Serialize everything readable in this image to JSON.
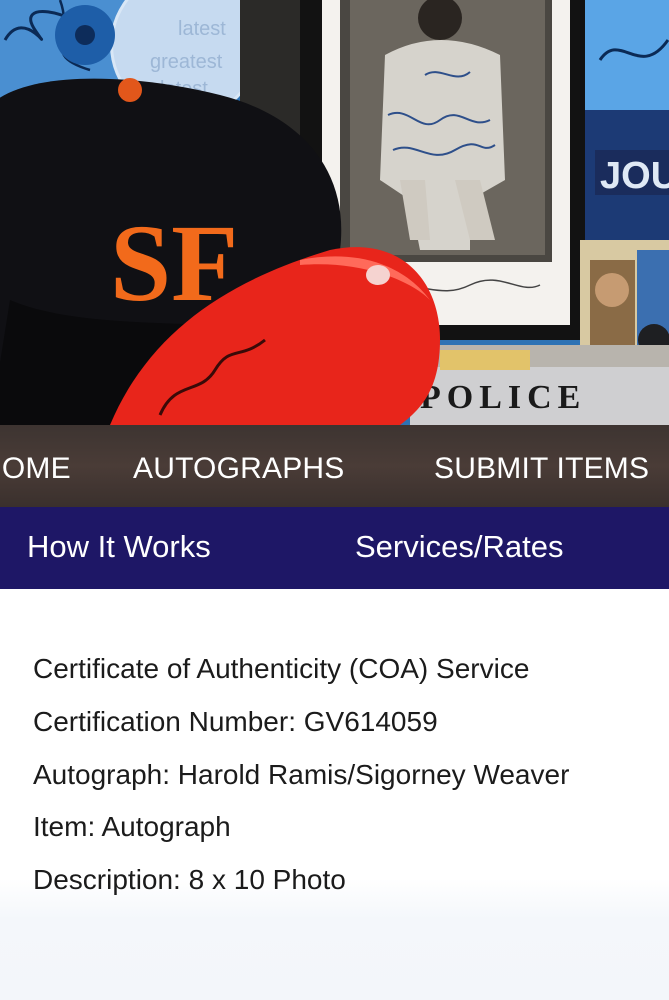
{
  "hero": {
    "cd_text": [
      "latest",
      "greatest",
      "latest"
    ],
    "boxing_glove_signature": "Manny",
    "police_sign": "POLICE",
    "colors": {
      "cap": "#101014",
      "sf_logo": "#f26a1b",
      "glove": "#e8251b",
      "frame": "#121212",
      "sky": "#2a6fb0"
    }
  },
  "main_nav": {
    "items": [
      "HOME",
      "AUTOGRAPHS",
      "SUBMIT ITEMS"
    ],
    "background": "#433734"
  },
  "sub_nav": {
    "items": [
      "How It Works",
      "Services/Rates"
    ],
    "background": "#1e1766"
  },
  "certificate": {
    "service": "Certificate of Authenticity (COA) Service",
    "cert_number": "Certification Number: GV614059",
    "autograph": "Autograph: Harold Ramis/Sigorney Weaver",
    "item": "Item: Autograph",
    "description": "Description: 8 x 10 Photo"
  }
}
